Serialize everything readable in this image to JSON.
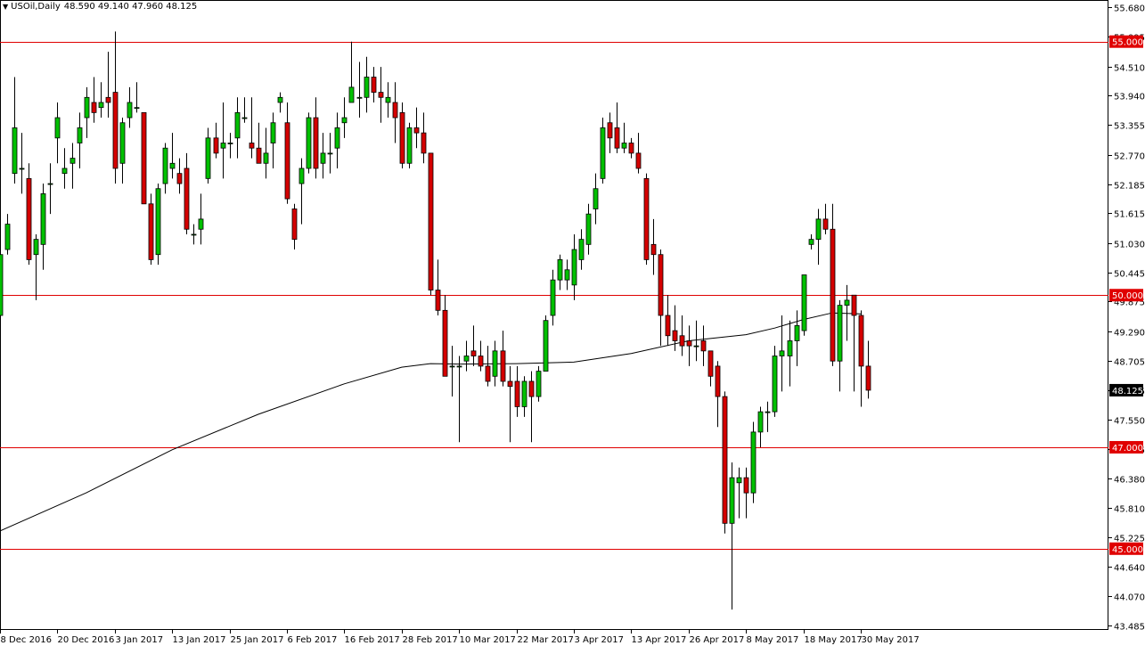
{
  "header": {
    "symbol": "USOil,Daily",
    "ohlc": "48.590 49.140 47.960 48.125",
    "arrow_icon": "triangle-down-icon"
  },
  "colors": {
    "bull": "#00c000",
    "bear": "#d40000",
    "wick": "#000000",
    "level_line": "#e00000",
    "ma_line": "#000000",
    "axis_text": "#000000",
    "level_label_bg": "#e00000",
    "price_label_bg": "#000000"
  },
  "chart_data": {
    "type": "candlestick",
    "title": "",
    "xlabel": "",
    "ylabel": "",
    "y_ticks": [
      55.68,
      55.095,
      54.51,
      53.94,
      53.355,
      52.77,
      52.185,
      51.615,
      51.03,
      50.445,
      49.875,
      49.29,
      48.705,
      48.125,
      47.55,
      46.965,
      46.38,
      45.81,
      45.225,
      44.64,
      44.07,
      43.485
    ],
    "y_tick_labels": [
      "55.680",
      "55.095",
      "54.510",
      "53.940",
      "53.355",
      "52.770",
      "52.185",
      "51.615",
      "51.030",
      "50.445",
      "49.875",
      "49.290",
      "48.705",
      "48.125",
      "47.550",
      "46.965",
      "46.380",
      "45.810",
      "45.225",
      "44.640",
      "44.070",
      "43.485"
    ],
    "ylim": [
      43.485,
      55.68
    ],
    "x_tick_labels": [
      "8 Dec 2016",
      "20 Dec 2016",
      "3 Jan 2017",
      "13 Jan 2017",
      "25 Jan 2017",
      "6 Feb 2017",
      "16 Feb 2017",
      "28 Feb 2017",
      "10 Mar 2017",
      "22 Mar 2017",
      "3 Apr 2017",
      "13 Apr 2017",
      "26 Apr 2017",
      "8 May 2017",
      "18 May 2017",
      "30 May 2017"
    ],
    "x_tick_candle_index": [
      0,
      8,
      16,
      24,
      32,
      40,
      48,
      56,
      64,
      72,
      80,
      88,
      96,
      104,
      112,
      120
    ],
    "horizontal_levels": [
      {
        "value": 55.0,
        "label": "55.000"
      },
      {
        "value": 50.0,
        "label": "50.000"
      },
      {
        "value": 47.0,
        "label": "47.000"
      },
      {
        "value": 45.0,
        "label": "45.000"
      }
    ],
    "current_price": {
      "value": 48.125,
      "label": "48.125"
    },
    "moving_average": [
      [
        0,
        45.35
      ],
      [
        12,
        46.1
      ],
      [
        24,
        46.95
      ],
      [
        36,
        47.65
      ],
      [
        48,
        48.25
      ],
      [
        56,
        48.58
      ],
      [
        60,
        48.65
      ],
      [
        64,
        48.64
      ],
      [
        72,
        48.65
      ],
      [
        80,
        48.68
      ],
      [
        88,
        48.85
      ],
      [
        96,
        49.1
      ],
      [
        104,
        49.22
      ],
      [
        108,
        49.35
      ],
      [
        112,
        49.52
      ],
      [
        116,
        49.65
      ],
      [
        120,
        49.63
      ]
    ],
    "candles": [
      {
        "o": 49.6,
        "h": 51.0,
        "l": 49.4,
        "c": 50.8
      },
      {
        "o": 50.9,
        "h": 51.6,
        "l": 50.8,
        "c": 51.4
      },
      {
        "o": 52.4,
        "h": 54.3,
        "l": 52.2,
        "c": 53.3
      },
      {
        "o": 52.5,
        "h": 53.2,
        "l": 52.0,
        "c": 52.5
      },
      {
        "o": 52.3,
        "h": 52.6,
        "l": 50.6,
        "c": 50.7
      },
      {
        "o": 50.8,
        "h": 51.2,
        "l": 49.9,
        "c": 51.1
      },
      {
        "o": 51.0,
        "h": 52.2,
        "l": 50.5,
        "c": 52.0
      },
      {
        "o": 52.2,
        "h": 52.6,
        "l": 51.6,
        "c": 52.2
      },
      {
        "o": 53.1,
        "h": 53.8,
        "l": 52.6,
        "c": 53.5
      },
      {
        "o": 52.4,
        "h": 52.9,
        "l": 52.1,
        "c": 52.5
      },
      {
        "o": 52.6,
        "h": 53.0,
        "l": 52.1,
        "c": 52.7
      },
      {
        "o": 53.0,
        "h": 53.6,
        "l": 52.5,
        "c": 53.3
      },
      {
        "o": 53.5,
        "h": 54.1,
        "l": 53.1,
        "c": 53.9
      },
      {
        "o": 53.8,
        "h": 54.3,
        "l": 53.4,
        "c": 53.6
      },
      {
        "o": 53.7,
        "h": 54.2,
        "l": 53.5,
        "c": 53.8
      },
      {
        "o": 53.9,
        "h": 54.8,
        "l": 53.5,
        "c": 53.8
      },
      {
        "o": 54.0,
        "h": 55.2,
        "l": 52.2,
        "c": 52.5
      },
      {
        "o": 52.6,
        "h": 53.5,
        "l": 52.2,
        "c": 53.4
      },
      {
        "o": 53.5,
        "h": 54.1,
        "l": 53.3,
        "c": 53.8
      },
      {
        "o": 53.7,
        "h": 54.2,
        "l": 53.6,
        "c": 53.7
      },
      {
        "o": 53.6,
        "h": 53.6,
        "l": 51.8,
        "c": 51.8
      },
      {
        "o": 51.8,
        "h": 52.0,
        "l": 50.6,
        "c": 50.7
      },
      {
        "o": 50.8,
        "h": 52.2,
        "l": 50.6,
        "c": 52.1
      },
      {
        "o": 52.2,
        "h": 53.0,
        "l": 52.0,
        "c": 52.9
      },
      {
        "o": 52.5,
        "h": 53.2,
        "l": 52.3,
        "c": 52.6
      },
      {
        "o": 52.4,
        "h": 52.7,
        "l": 52.0,
        "c": 52.2
      },
      {
        "o": 52.5,
        "h": 52.8,
        "l": 51.2,
        "c": 51.3
      },
      {
        "o": 51.2,
        "h": 51.4,
        "l": 51.0,
        "c": 51.2
      },
      {
        "o": 51.3,
        "h": 52.0,
        "l": 51.0,
        "c": 51.5
      },
      {
        "o": 52.3,
        "h": 53.3,
        "l": 52.2,
        "c": 53.1
      },
      {
        "o": 53.1,
        "h": 53.4,
        "l": 52.7,
        "c": 52.8
      },
      {
        "o": 52.9,
        "h": 53.8,
        "l": 52.3,
        "c": 53.0
      },
      {
        "o": 53.0,
        "h": 53.2,
        "l": 52.7,
        "c": 53.0
      },
      {
        "o": 53.1,
        "h": 53.9,
        "l": 52.7,
        "c": 53.6
      },
      {
        "o": 53.5,
        "h": 53.9,
        "l": 53.4,
        "c": 53.5
      },
      {
        "o": 53.0,
        "h": 53.9,
        "l": 52.7,
        "c": 52.9
      },
      {
        "o": 52.9,
        "h": 53.4,
        "l": 52.6,
        "c": 52.6
      },
      {
        "o": 52.6,
        "h": 53.3,
        "l": 52.3,
        "c": 52.8
      },
      {
        "o": 53.0,
        "h": 53.6,
        "l": 52.5,
        "c": 53.4
      },
      {
        "o": 53.8,
        "h": 54.0,
        "l": 53.6,
        "c": 53.9
      },
      {
        "o": 53.4,
        "h": 53.8,
        "l": 51.8,
        "c": 51.9
      },
      {
        "o": 51.7,
        "h": 51.8,
        "l": 50.9,
        "c": 51.1
      },
      {
        "o": 52.2,
        "h": 52.7,
        "l": 51.4,
        "c": 52.5
      },
      {
        "o": 52.5,
        "h": 53.6,
        "l": 52.4,
        "c": 53.5
      },
      {
        "o": 53.5,
        "h": 53.9,
        "l": 52.3,
        "c": 52.5
      },
      {
        "o": 52.6,
        "h": 53.2,
        "l": 52.3,
        "c": 52.8
      },
      {
        "o": 52.8,
        "h": 53.2,
        "l": 52.4,
        "c": 52.8
      },
      {
        "o": 52.9,
        "h": 53.6,
        "l": 52.5,
        "c": 53.3
      },
      {
        "o": 53.4,
        "h": 53.9,
        "l": 53.1,
        "c": 53.5
      },
      {
        "o": 53.8,
        "h": 55.0,
        "l": 53.8,
        "c": 54.1
      },
      {
        "o": 53.9,
        "h": 54.6,
        "l": 53.5,
        "c": 53.9
      },
      {
        "o": 53.9,
        "h": 54.7,
        "l": 53.6,
        "c": 54.3
      },
      {
        "o": 54.3,
        "h": 54.5,
        "l": 53.8,
        "c": 54.0
      },
      {
        "o": 54.0,
        "h": 54.5,
        "l": 53.4,
        "c": 53.9
      },
      {
        "o": 53.8,
        "h": 54.2,
        "l": 53.5,
        "c": 53.9
      },
      {
        "o": 53.8,
        "h": 54.2,
        "l": 53.0,
        "c": 53.5
      },
      {
        "o": 53.6,
        "h": 53.8,
        "l": 52.5,
        "c": 52.6
      },
      {
        "o": 52.6,
        "h": 53.4,
        "l": 52.5,
        "c": 53.3
      },
      {
        "o": 53.3,
        "h": 53.7,
        "l": 52.9,
        "c": 53.2
      },
      {
        "o": 53.2,
        "h": 53.6,
        "l": 52.6,
        "c": 52.8
      },
      {
        "o": 52.8,
        "h": 52.8,
        "l": 50.0,
        "c": 50.1
      },
      {
        "o": 50.1,
        "h": 50.7,
        "l": 49.6,
        "c": 49.7
      },
      {
        "o": 49.7,
        "h": 50.0,
        "l": 48.4,
        "c": 48.4
      },
      {
        "o": 48.6,
        "h": 49.0,
        "l": 48.0,
        "c": 48.6
      },
      {
        "o": 48.6,
        "h": 48.8,
        "l": 47.1,
        "c": 48.6
      },
      {
        "o": 48.7,
        "h": 49.1,
        "l": 48.5,
        "c": 48.8
      },
      {
        "o": 48.9,
        "h": 49.4,
        "l": 48.6,
        "c": 48.8
      },
      {
        "o": 48.8,
        "h": 49.1,
        "l": 48.5,
        "c": 48.6
      },
      {
        "o": 48.6,
        "h": 49.0,
        "l": 48.2,
        "c": 48.3
      },
      {
        "o": 48.4,
        "h": 49.1,
        "l": 48.2,
        "c": 48.9
      },
      {
        "o": 48.9,
        "h": 49.3,
        "l": 48.2,
        "c": 48.3
      },
      {
        "o": 48.3,
        "h": 48.6,
        "l": 47.1,
        "c": 48.2
      },
      {
        "o": 48.3,
        "h": 48.6,
        "l": 47.6,
        "c": 47.8
      },
      {
        "o": 47.8,
        "h": 48.4,
        "l": 47.6,
        "c": 48.3
      },
      {
        "o": 48.3,
        "h": 48.5,
        "l": 47.1,
        "c": 48.0
      },
      {
        "o": 48.0,
        "h": 48.6,
        "l": 47.9,
        "c": 48.5
      },
      {
        "o": 48.5,
        "h": 49.6,
        "l": 48.5,
        "c": 49.5
      },
      {
        "o": 49.6,
        "h": 50.5,
        "l": 49.4,
        "c": 50.3
      },
      {
        "o": 50.3,
        "h": 50.8,
        "l": 50.1,
        "c": 50.7
      },
      {
        "o": 50.3,
        "h": 50.7,
        "l": 50.1,
        "c": 50.5
      },
      {
        "o": 50.2,
        "h": 51.2,
        "l": 49.9,
        "c": 50.9
      },
      {
        "o": 50.7,
        "h": 51.3,
        "l": 50.5,
        "c": 51.1
      },
      {
        "o": 51.0,
        "h": 51.8,
        "l": 50.8,
        "c": 51.6
      },
      {
        "o": 51.7,
        "h": 52.4,
        "l": 51.4,
        "c": 52.1
      },
      {
        "o": 52.3,
        "h": 53.5,
        "l": 52.2,
        "c": 53.3
      },
      {
        "o": 53.4,
        "h": 53.6,
        "l": 52.8,
        "c": 53.1
      },
      {
        "o": 53.3,
        "h": 53.8,
        "l": 52.8,
        "c": 52.9
      },
      {
        "o": 52.9,
        "h": 53.4,
        "l": 52.8,
        "c": 53.0
      },
      {
        "o": 53.0,
        "h": 53.1,
        "l": 52.7,
        "c": 52.8
      },
      {
        "o": 52.8,
        "h": 53.2,
        "l": 52.4,
        "c": 52.5
      },
      {
        "o": 52.3,
        "h": 52.4,
        "l": 50.6,
        "c": 50.7
      },
      {
        "o": 51.0,
        "h": 51.5,
        "l": 50.4,
        "c": 50.8
      },
      {
        "o": 50.8,
        "h": 50.9,
        "l": 49.0,
        "c": 49.6
      },
      {
        "o": 49.6,
        "h": 50.0,
        "l": 49.0,
        "c": 49.2
      },
      {
        "o": 49.3,
        "h": 49.8,
        "l": 48.9,
        "c": 49.1
      },
      {
        "o": 49.2,
        "h": 49.6,
        "l": 48.8,
        "c": 49.0
      },
      {
        "o": 49.1,
        "h": 49.4,
        "l": 48.6,
        "c": 49.0
      },
      {
        "o": 49.0,
        "h": 49.5,
        "l": 48.7,
        "c": 49.0
      },
      {
        "o": 49.1,
        "h": 49.4,
        "l": 48.6,
        "c": 48.9
      },
      {
        "o": 48.9,
        "h": 48.9,
        "l": 48.2,
        "c": 48.4
      },
      {
        "o": 48.6,
        "h": 48.7,
        "l": 47.4,
        "c": 48.0
      },
      {
        "o": 48.0,
        "h": 48.1,
        "l": 45.3,
        "c": 45.5
      },
      {
        "o": 45.5,
        "h": 46.7,
        "l": 43.8,
        "c": 46.4
      },
      {
        "o": 46.3,
        "h": 46.6,
        "l": 45.6,
        "c": 46.4
      },
      {
        "o": 46.4,
        "h": 46.6,
        "l": 45.6,
        "c": 46.1
      },
      {
        "o": 46.1,
        "h": 47.5,
        "l": 45.9,
        "c": 47.3
      },
      {
        "o": 47.3,
        "h": 47.8,
        "l": 47.0,
        "c": 47.7
      },
      {
        "o": 47.7,
        "h": 47.9,
        "l": 47.3,
        "c": 47.7
      },
      {
        "o": 47.7,
        "h": 49.0,
        "l": 47.6,
        "c": 48.8
      },
      {
        "o": 48.8,
        "h": 49.6,
        "l": 48.1,
        "c": 48.9
      },
      {
        "o": 48.8,
        "h": 49.5,
        "l": 48.2,
        "c": 49.1
      },
      {
        "o": 49.1,
        "h": 49.7,
        "l": 48.6,
        "c": 49.4
      },
      {
        "o": 49.3,
        "h": 50.4,
        "l": 49.2,
        "c": 50.4
      },
      {
        "o": 51.0,
        "h": 51.2,
        "l": 50.9,
        "c": 51.1
      },
      {
        "o": 51.1,
        "h": 51.7,
        "l": 50.6,
        "c": 51.5
      },
      {
        "o": 51.5,
        "h": 51.8,
        "l": 51.2,
        "c": 51.3
      },
      {
        "o": 51.3,
        "h": 51.8,
        "l": 48.6,
        "c": 48.7
      },
      {
        "o": 48.7,
        "h": 49.9,
        "l": 48.1,
        "c": 49.8
      },
      {
        "o": 49.8,
        "h": 50.2,
        "l": 49.1,
        "c": 49.9
      },
      {
        "o": 50.0,
        "h": 50.0,
        "l": 48.1,
        "c": 49.6
      },
      {
        "o": 49.6,
        "h": 49.7,
        "l": 47.8,
        "c": 48.6
      },
      {
        "o": 48.6,
        "h": 49.1,
        "l": 47.96,
        "c": 48.125
      }
    ]
  }
}
